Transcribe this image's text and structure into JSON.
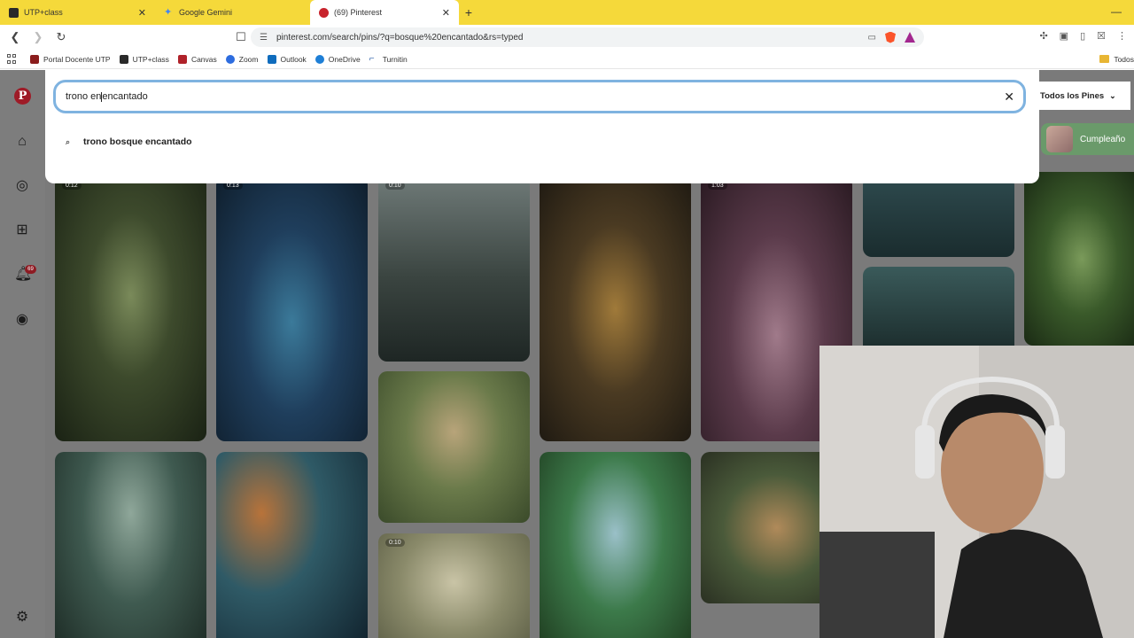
{
  "browser": {
    "tabs": [
      {
        "title": "UTP+class",
        "active": false
      },
      {
        "title": "Google Gemini",
        "active": false
      },
      {
        "title": "(69) Pinterest",
        "active": true
      }
    ],
    "url": "pinterest.com/search/pins/?q=bosque%20encantado&rs=typed",
    "bookmarks": [
      "Portal Docente UTP",
      "UTP+class",
      "Canvas",
      "Zoom",
      "Outlook",
      "OneDrive",
      "Turnitin"
    ],
    "bookmarks_folder": "Todos"
  },
  "sidebar": {
    "notification_count": "69"
  },
  "search": {
    "typed_before_caret": "trono en",
    "typed_after_caret": "encantado",
    "suggestion": "trono bosque encantado",
    "filter_label": "Todos los Pines",
    "chip_label": "Cumpleaño"
  },
  "pins": {
    "durations": [
      "0:12",
      "0:13",
      "0:10",
      "1:03",
      "0:10"
    ]
  },
  "colors": {
    "tabstrip": "#f5d93a",
    "pinterest_red": "#9e1b27",
    "search_focus": "#7fb3e0"
  }
}
